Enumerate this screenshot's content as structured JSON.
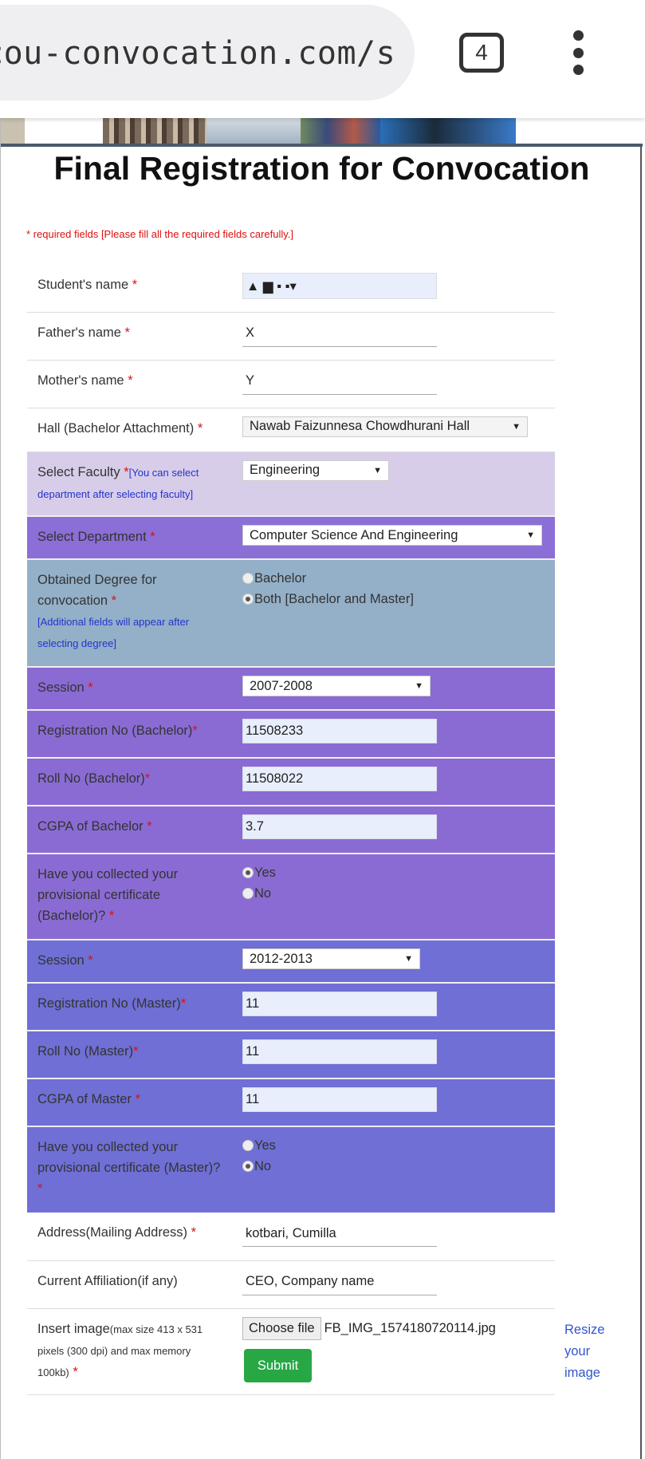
{
  "browser": {
    "url": "cou-convocation.com/s",
    "tab_count": "4"
  },
  "page": {
    "title": "Final Registration for Convocation",
    "required_note": "* required fields [Please fill all the required fields carefully.]"
  },
  "fields": {
    "student_name": {
      "label": "Student's name",
      "value": "▲ ▆ ▪ ▪▾"
    },
    "father_name": {
      "label": "Father's name",
      "value": "X"
    },
    "mother_name": {
      "label": "Mother's name",
      "value": "Y"
    },
    "hall": {
      "label": "Hall (Bachelor Attachment)",
      "value": "Nawab Faizunnesa Chowdhurani Hall"
    },
    "faculty": {
      "label": "Select Faculty",
      "hint": "[You can select department after selecting faculty]",
      "value": "Engineering"
    },
    "department": {
      "label": "Select Department",
      "value": "Computer Science And Engineering"
    },
    "degree": {
      "label": "Obtained Degree for convocation",
      "hint": "[Additional fields will appear after selecting degree]",
      "options": [
        "Bachelor",
        "Both [Bachelor and Master]"
      ],
      "selected": 1
    },
    "bachelor": {
      "session_label": "Session",
      "session_value": "2007-2008",
      "reg_label": "Registration No (Bachelor)",
      "reg_value": "11508233",
      "roll_label": "Roll No (Bachelor)",
      "roll_value": "11508022",
      "cgpa_label": "CGPA of Bachelor",
      "cgpa_value": "3.7",
      "cert_label": "Have you collected your provisional certificate (Bachelor)?",
      "cert_options": [
        "Yes",
        "No"
      ],
      "cert_selected": 0
    },
    "master": {
      "session_label": "Session",
      "session_value": "2012-2013",
      "reg_label": "Registration No (Master)",
      "reg_value": "11",
      "roll_label": "Roll No (Master)",
      "roll_value": "11",
      "cgpa_label": "CGPA of Master",
      "cgpa_value": "11",
      "cert_label": "Have you collected your provisional certificate (Master)?",
      "cert_options": [
        "Yes",
        "No"
      ],
      "cert_selected": 1
    },
    "address": {
      "label": "Address(Mailing Address)",
      "value": "kotbari, Cumilla"
    },
    "affiliation": {
      "label": "Current Affiliation(if any)",
      "value": "CEO, Company name"
    },
    "image": {
      "label": "Insert image",
      "hint": "(max size 413 x 531 pixels (300 dpi) and max memory 100kb)",
      "button": "Choose file",
      "filename": "FB_IMG_1574180720114.jpg",
      "resize_link": "Resize your image"
    }
  },
  "actions": {
    "submit": "Submit"
  },
  "required_mark": "*"
}
